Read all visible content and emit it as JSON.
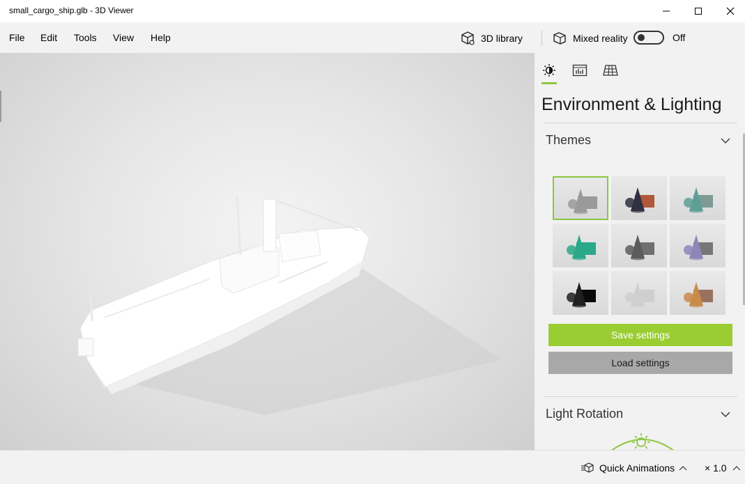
{
  "window": {
    "title": "small_cargo_ship.glb - 3D Viewer",
    "minimize_icon": "minimize-icon",
    "maximize_icon": "maximize-icon",
    "close_icon": "close-icon"
  },
  "menu": {
    "items": [
      "File",
      "Edit",
      "Tools",
      "View",
      "Help"
    ],
    "library_label": "3D library",
    "mixed_reality_label": "Mixed reality",
    "toggle_state": "Off"
  },
  "panel": {
    "tabs": [
      "environment-lighting-icon",
      "stats-icon",
      "grid-icon"
    ],
    "title": "Environment & Lighting",
    "themes_heading": "Themes",
    "themes": [
      {
        "name": "gray",
        "primary": "#9a9a9a",
        "secondary": "#9a9a9a",
        "selected": true
      },
      {
        "name": "dark-rust",
        "primary": "#2f3040",
        "secondary": "#b0583a",
        "selected": false
      },
      {
        "name": "teal-gray",
        "primary": "#5f9f95",
        "secondary": "#7f9a94",
        "selected": false
      },
      {
        "name": "teal",
        "primary": "#2aa88a",
        "secondary": "#2aa88a",
        "selected": false
      },
      {
        "name": "dark-gray",
        "primary": "#5c5c5c",
        "secondary": "#6f6f6f",
        "selected": false
      },
      {
        "name": "lavender",
        "primary": "#8e86b8",
        "secondary": "#777",
        "selected": false
      },
      {
        "name": "black",
        "primary": "#202020",
        "secondary": "#0a0a0a",
        "selected": false
      },
      {
        "name": "light",
        "primary": "#cfcfcf",
        "secondary": "#cfcfcf",
        "selected": false
      },
      {
        "name": "copper-blue",
        "primary": "#c98a4a",
        "secondary": "#9a7060",
        "selected": false
      }
    ],
    "save_label": "Save settings",
    "load_label": "Load settings",
    "light_rotation_heading": "Light Rotation"
  },
  "bottom": {
    "quick_animations_label": "Quick Animations",
    "speed_label": "× 1.0"
  },
  "colors": {
    "accent": "#8cc63f",
    "save_button": "#9acd32",
    "load_button": "#a8a8a8"
  }
}
